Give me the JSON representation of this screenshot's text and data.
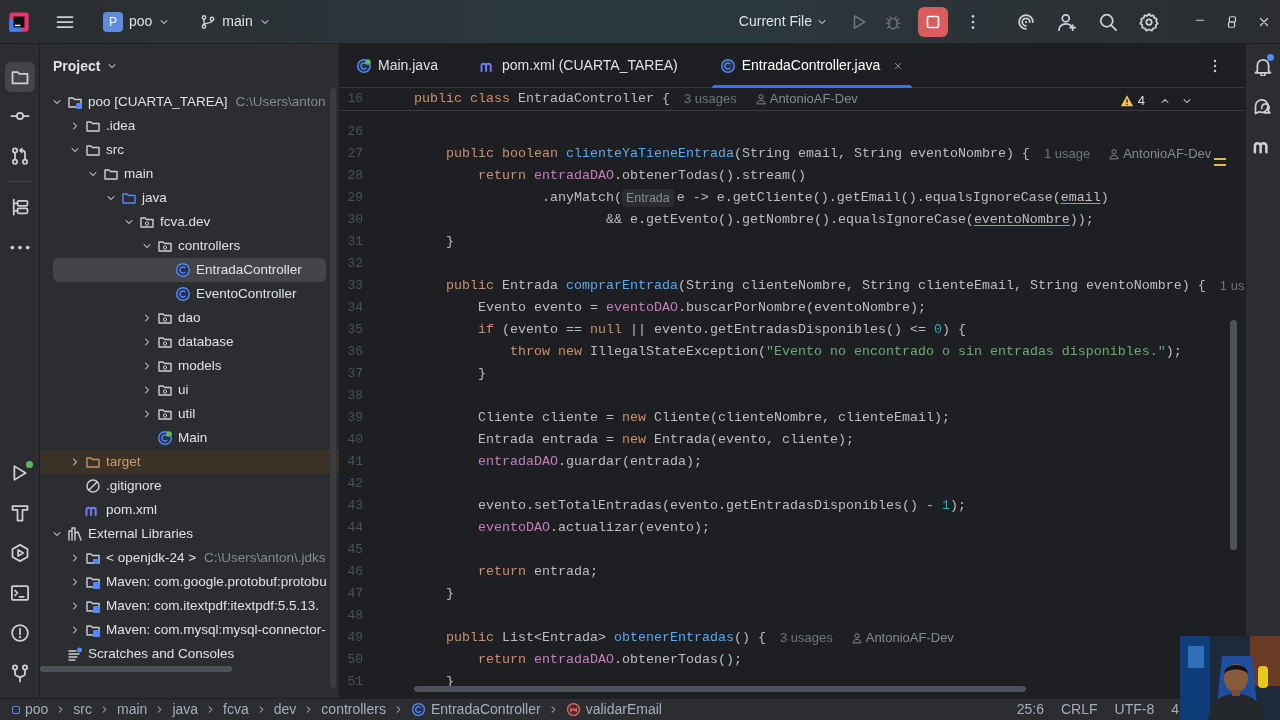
{
  "title_bar": {
    "project_badge": "P",
    "project": "poo",
    "branch": "main",
    "run_config": "Current File",
    "stop_active": true
  },
  "left_toolbar": {
    "top": [
      {
        "kind": "project",
        "selected": true
      },
      {
        "kind": "commit",
        "selected": false
      },
      {
        "kind": "pull_requests",
        "selected": false
      },
      {
        "kind": "structure",
        "selected": false
      },
      {
        "kind": "more",
        "selected": false
      }
    ],
    "bottom": [
      {
        "kind": "run",
        "selected": false,
        "badge": true
      },
      {
        "kind": "build",
        "selected": false,
        "badge": false
      },
      {
        "kind": "services",
        "selected": false,
        "badge": false
      },
      {
        "kind": "terminal",
        "selected": false,
        "badge": false
      },
      {
        "kind": "problems",
        "selected": false,
        "badge": false
      },
      {
        "kind": "git",
        "selected": false,
        "badge": false
      }
    ]
  },
  "project_panel": {
    "title": "Project",
    "tree": [
      {
        "label": "poo [CUARTA_TAREA]",
        "kind": "module",
        "hint": "C:\\Users\\anton",
        "expanded": true,
        "selected": false,
        "children": [
          {
            "label": ".idea",
            "kind": "folder",
            "expanded": false,
            "selected": false
          },
          {
            "label": "src",
            "kind": "folder",
            "expanded": true,
            "selected": false,
            "children": [
              {
                "label": "main",
                "kind": "folder",
                "expanded": true,
                "selected": false,
                "children": [
                  {
                    "label": "java",
                    "kind": "source",
                    "expanded": true,
                    "selected": false,
                    "children": [
                      {
                        "label": "fcva.dev",
                        "kind": "package",
                        "expanded": true,
                        "selected": false,
                        "children": [
                          {
                            "label": "controllers",
                            "kind": "package",
                            "expanded": true,
                            "selected": false,
                            "children": [
                              {
                                "label": "EntradaController",
                                "kind": "class",
                                "selected": true
                              },
                              {
                                "label": "EventoController",
                                "kind": "class",
                                "selected": false
                              }
                            ]
                          },
                          {
                            "label": "dao",
                            "kind": "package",
                            "expanded": false,
                            "selected": false
                          },
                          {
                            "label": "database",
                            "kind": "package",
                            "expanded": false,
                            "selected": false
                          },
                          {
                            "label": "models",
                            "kind": "package",
                            "expanded": false,
                            "selected": false
                          },
                          {
                            "label": "ui",
                            "kind": "package",
                            "expanded": false,
                            "selected": false
                          },
                          {
                            "label": "util",
                            "kind": "package",
                            "expanded": false,
                            "selected": false
                          },
                          {
                            "label": "Main",
                            "kind": "main_class",
                            "selected": false
                          }
                        ]
                      }
                    ]
                  }
                ]
              }
            ]
          },
          {
            "label": "target",
            "kind": "excluded",
            "expanded": false,
            "selected": false
          },
          {
            "label": ".gitignore",
            "kind": "ignore",
            "selected": false
          },
          {
            "label": "pom.xml",
            "kind": "maven",
            "selected": false
          }
        ]
      },
      {
        "label": "External Libraries",
        "kind": "libraries",
        "expanded": true,
        "selected": false,
        "children": [
          {
            "label": "< openjdk-24 >",
            "kind": "jdk",
            "hint": "C:\\Users\\anton\\.jdks",
            "expanded": false,
            "selected": false
          },
          {
            "label": "Maven: com.google.protobuf:protobu",
            "kind": "library",
            "expanded": false,
            "selected": false
          },
          {
            "label": "Maven: com.itextpdf:itextpdf:5.5.13.",
            "kind": "library",
            "expanded": false,
            "selected": false
          },
          {
            "label": "Maven: com.mysql:mysql-connector-",
            "kind": "library",
            "expanded": false,
            "selected": false
          }
        ]
      },
      {
        "label": "Scratches and Consoles",
        "kind": "scratches",
        "selected": false
      }
    ]
  },
  "tabs": [
    {
      "label": "Main.java",
      "kind": "main_class",
      "selected": false,
      "closable": false
    },
    {
      "label": "pom.xml (CUARTA_TAREA)",
      "kind": "maven",
      "selected": false,
      "closable": false
    },
    {
      "label": "EntradaController.java",
      "kind": "class",
      "selected": true,
      "closable": true
    }
  ],
  "editor": {
    "warnings": "4",
    "sticky_line": {
      "number": "16",
      "tokens": [
        {
          "kind": "keyword",
          "text": "public class "
        },
        {
          "kind": "plain",
          "text": "EntradaController { "
        },
        {
          "kind": "usage",
          "text": "3 usages"
        },
        {
          "kind": "author",
          "text": "AntonioAF-Dev"
        }
      ]
    },
    "lines": [
      {
        "number": "26"
      },
      {
        "number": "27",
        "tokens": [
          {
            "kind": "keyword",
            "text": "    public boolean "
          },
          {
            "kind": "method",
            "text": "clienteYaTieneEntrada"
          },
          {
            "kind": "plain",
            "text": "(String email, String eventoNombre) { "
          },
          {
            "kind": "usage",
            "text": "1 usage"
          },
          {
            "kind": "author",
            "text": "AntonioAF-Dev"
          }
        ]
      },
      {
        "number": "28",
        "tokens": [
          {
            "kind": "keyword",
            "text": "        return "
          },
          {
            "kind": "field",
            "text": "entradaDAO"
          },
          {
            "kind": "plain",
            "text": ".obtenerTodas().stream()"
          }
        ]
      },
      {
        "number": "29",
        "tokens": [
          {
            "kind": "plain",
            "text": "                .anyMatch("
          },
          {
            "kind": "type_hint",
            "text": "Entrada"
          },
          {
            "kind": "plain",
            "text": "e -> e.getCliente().getEmail().equalsIgnoreCase("
          },
          {
            "kind": "param",
            "text": "email"
          },
          {
            "kind": "plain",
            "text": ")"
          }
        ]
      },
      {
        "number": "30",
        "tokens": [
          {
            "kind": "plain",
            "text": "                        && e.getEvento().getNombre().equalsIgnoreCase("
          },
          {
            "kind": "param",
            "text": "eventoNombre"
          },
          {
            "kind": "plain",
            "text": "));"
          }
        ]
      },
      {
        "number": "31",
        "tokens": [
          {
            "kind": "plain",
            "text": "    }"
          }
        ]
      },
      {
        "number": "32"
      },
      {
        "number": "33",
        "tokens": [
          {
            "kind": "keyword",
            "text": "    public "
          },
          {
            "kind": "plain",
            "text": "Entrada "
          },
          {
            "kind": "method",
            "text": "comprarEntrada"
          },
          {
            "kind": "plain",
            "text": "(String clienteNombre, String clienteEmail, String eventoNombre) { "
          },
          {
            "kind": "usage",
            "text": "1 us"
          }
        ]
      },
      {
        "number": "34",
        "tokens": [
          {
            "kind": "plain",
            "text": "        Evento evento = "
          },
          {
            "kind": "field",
            "text": "eventoDAO"
          },
          {
            "kind": "plain",
            "text": ".buscarPorNombre(eventoNombre);"
          }
        ]
      },
      {
        "number": "35",
        "tokens": [
          {
            "kind": "keyword",
            "text": "        if "
          },
          {
            "kind": "plain",
            "text": "(evento == "
          },
          {
            "kind": "keyword",
            "text": "null"
          },
          {
            "kind": "plain",
            "text": " || evento.getEntradasDisponibles() <= "
          },
          {
            "kind": "number",
            "text": "0"
          },
          {
            "kind": "plain",
            "text": ") {"
          }
        ]
      },
      {
        "number": "36",
        "tokens": [
          {
            "kind": "keyword",
            "text": "            throw new "
          },
          {
            "kind": "plain",
            "text": "IllegalStateException("
          },
          {
            "kind": "string",
            "text": "\"Evento no encontrado o sin entradas disponibles.\""
          },
          {
            "kind": "plain",
            "text": ");"
          }
        ]
      },
      {
        "number": "37",
        "tokens": [
          {
            "kind": "plain",
            "text": "        }"
          }
        ]
      },
      {
        "number": "38"
      },
      {
        "number": "39",
        "tokens": [
          {
            "kind": "plain",
            "text": "        Cliente cliente = "
          },
          {
            "kind": "keyword",
            "text": "new "
          },
          {
            "kind": "plain",
            "text": "Cliente(clienteNombre, clienteEmail);"
          }
        ]
      },
      {
        "number": "40",
        "tokens": [
          {
            "kind": "plain",
            "text": "        Entrada entrada = "
          },
          {
            "kind": "keyword",
            "text": "new "
          },
          {
            "kind": "plain",
            "text": "Entrada(evento, cliente);"
          }
        ]
      },
      {
        "number": "41",
        "tokens": [
          {
            "kind": "field",
            "text": "        entradaDAO"
          },
          {
            "kind": "plain",
            "text": ".guardar(entrada);"
          }
        ]
      },
      {
        "number": "42"
      },
      {
        "number": "43",
        "tokens": [
          {
            "kind": "plain",
            "text": "        evento.setTotalEntradas(evento.getEntradasDisponibles() - "
          },
          {
            "kind": "number",
            "text": "1"
          },
          {
            "kind": "plain",
            "text": ");"
          }
        ]
      },
      {
        "number": "44",
        "tokens": [
          {
            "kind": "field",
            "text": "        eventoDAO"
          },
          {
            "kind": "plain",
            "text": ".actualizar(evento);"
          }
        ]
      },
      {
        "number": "45"
      },
      {
        "number": "46",
        "tokens": [
          {
            "kind": "keyword",
            "text": "        return "
          },
          {
            "kind": "plain",
            "text": "entrada;"
          }
        ]
      },
      {
        "number": "47",
        "tokens": [
          {
            "kind": "plain",
            "text": "    }"
          }
        ]
      },
      {
        "number": "48"
      },
      {
        "number": "49",
        "tokens": [
          {
            "kind": "keyword",
            "text": "    public "
          },
          {
            "kind": "plain",
            "text": "List<Entrada> "
          },
          {
            "kind": "method",
            "text": "obtenerEntradas"
          },
          {
            "kind": "plain",
            "text": "() { "
          },
          {
            "kind": "usage",
            "text": "3 usages"
          },
          {
            "kind": "author",
            "text": "AntonioAF-Dev"
          }
        ]
      },
      {
        "number": "50",
        "tokens": [
          {
            "kind": "keyword",
            "text": "        return "
          },
          {
            "kind": "field",
            "text": "entradaDAO"
          },
          {
            "kind": "plain",
            "text": ".obtenerTodas();"
          }
        ]
      },
      {
        "number": "51",
        "tokens": [
          {
            "kind": "plain",
            "text": "    }"
          }
        ]
      }
    ]
  },
  "right_toolbar": [
    {
      "kind": "notifications",
      "badge": true
    },
    {
      "kind": "ai_chat",
      "badge": false
    },
    {
      "kind": "maven",
      "badge": false
    }
  ],
  "breadcrumbs": [
    {
      "label": "poo",
      "kind": "module"
    },
    {
      "label": "src",
      "kind": "folder"
    },
    {
      "label": "main",
      "kind": "folder"
    },
    {
      "label": "java",
      "kind": "folder"
    },
    {
      "label": "fcva",
      "kind": "folder"
    },
    {
      "label": "dev",
      "kind": "folder"
    },
    {
      "label": "controllers",
      "kind": "folder"
    },
    {
      "label": "EntradaController",
      "kind": "class"
    },
    {
      "label": "validarEmail",
      "kind": "method"
    }
  ],
  "status_bar": [
    "25:6",
    "CRLF",
    "UTF-8",
    "4"
  ],
  "webcam": {
    "kind": "picture"
  }
}
